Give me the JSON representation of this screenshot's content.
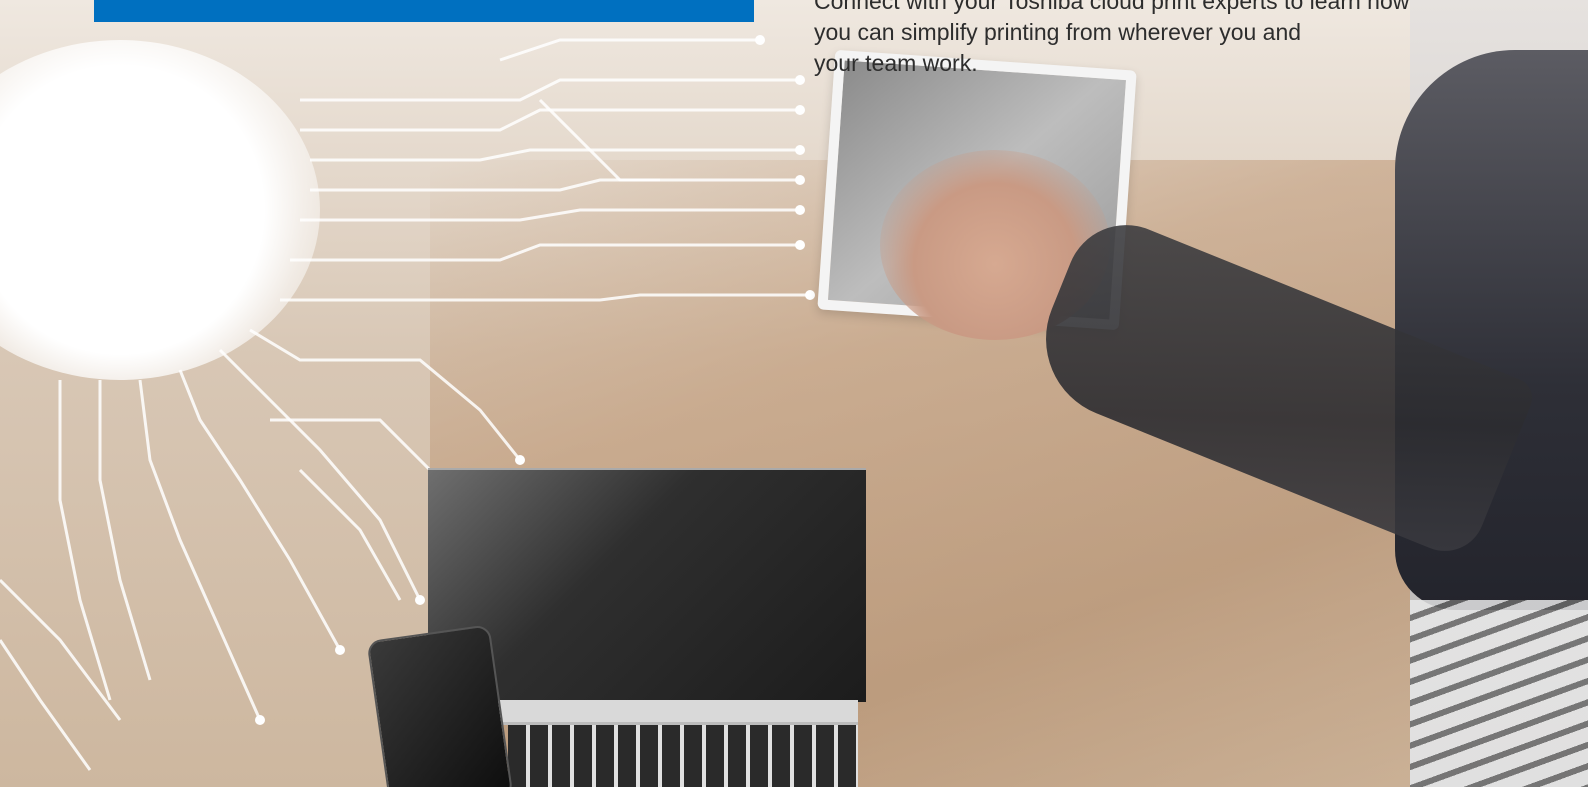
{
  "cta": {
    "lines": [
      "Connect with your Toshiba cloud print experts to learn how",
      "you can simplify printing from wherever you and",
      " your team work."
    ]
  },
  "colors": {
    "accent": "#0070c0",
    "text": "#2d2d2d"
  }
}
